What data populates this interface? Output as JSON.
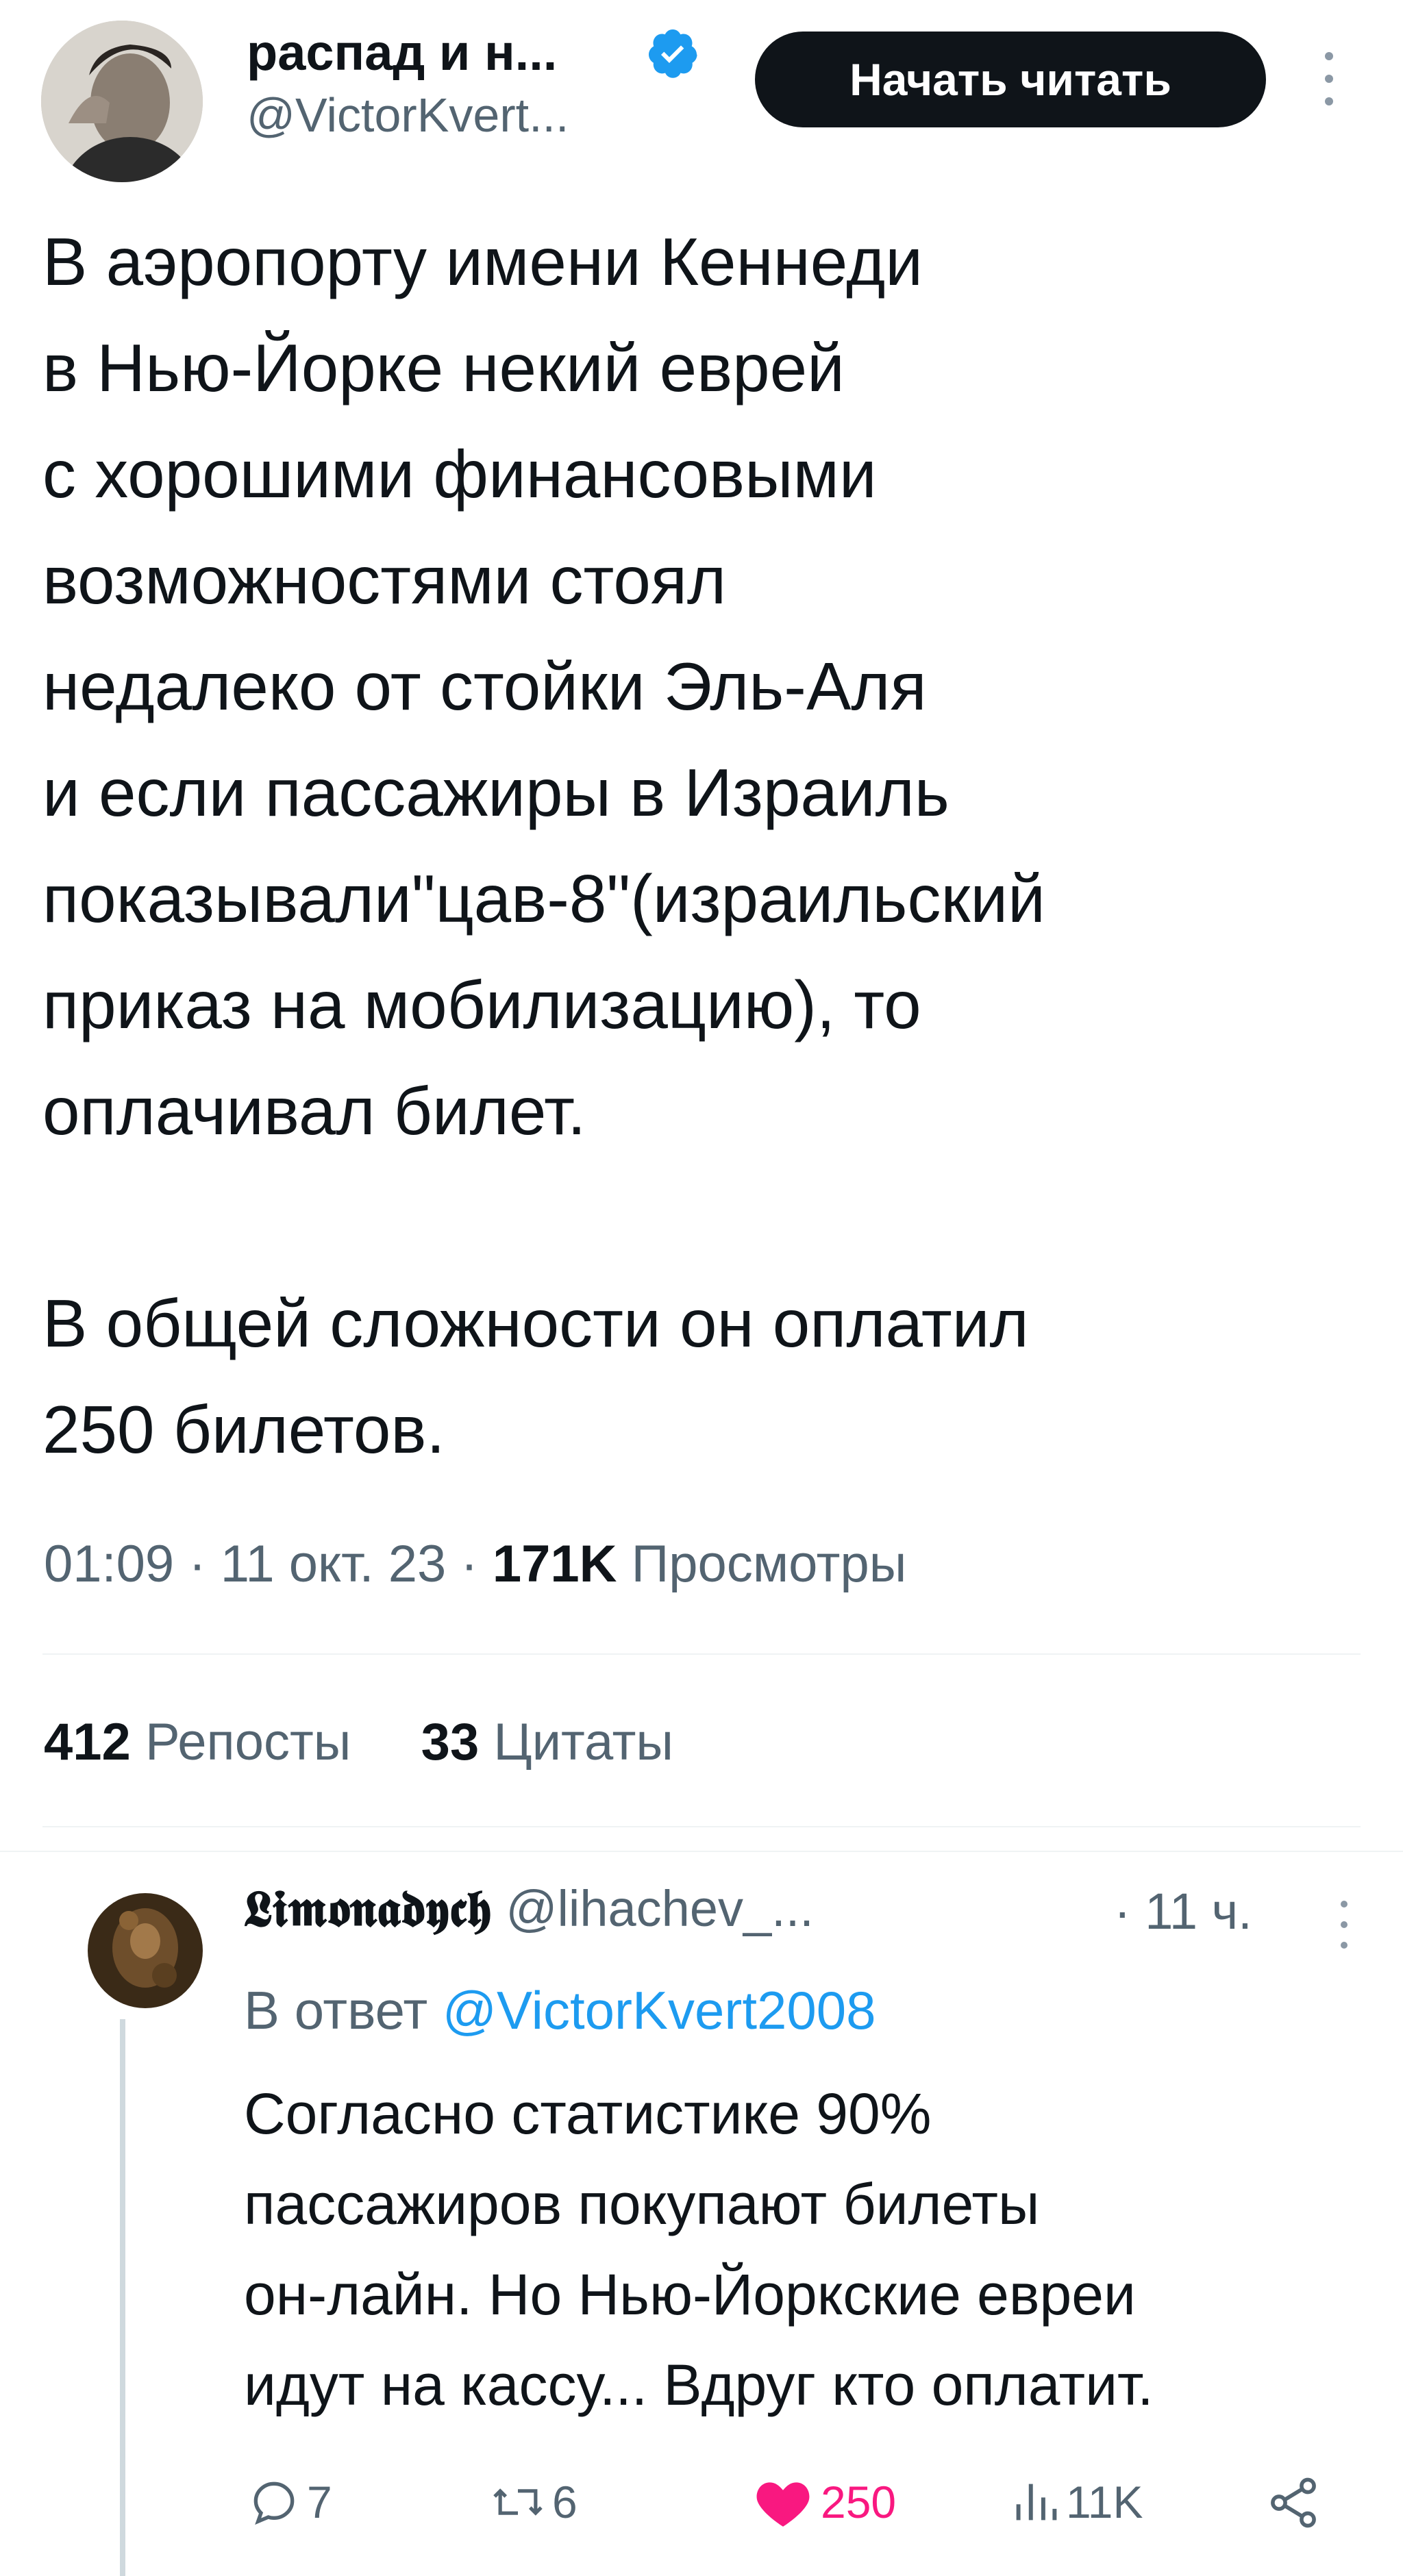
{
  "author": {
    "display_name": "распад и н...",
    "handle": "@VictorKvert...",
    "verified": true,
    "follow_button": "Начать читать"
  },
  "tweet": {
    "lines": [
      "В аэропорту имени Кеннеди",
      "в Нью-Йорке некий еврей",
      "с хорошими финансовыми",
      "возможностями стоял",
      "недалеко от стойки Эль-Аля",
      "и если пассажиры в Израиль",
      "показывали\"цав-8\"(израильский",
      "приказ на мобилизацию), то",
      "оплачивал билет.",
      "В общей сложности он оплатил",
      "250 билетов."
    ],
    "meta": {
      "time": "01:09",
      "sep1": "·",
      "date": "11 окт. 23",
      "sep2": "·",
      "views_count": "171K",
      "views_label": "Просмотры"
    },
    "stats": {
      "reposts_count": "412",
      "reposts_label": "Репосты",
      "quotes_count": "33",
      "quotes_label": "Цитаты"
    }
  },
  "reply": {
    "display_name": "𝕷𝖎𝖒𝖔𝖓𝖆𝖉𝖞𝖈𝖍",
    "handle": "@lihachev_...",
    "time": "· 11 ч.",
    "reply_prefix": "В ответ",
    "reply_to": "@VictorKvert2008",
    "lines": [
      "Согласно статистике 90%",
      "пассажиров покупают билеты",
      "он-лайн. Но Нью-Йоркские евреи",
      "идут на кассу... Вдруг кто оплатит."
    ],
    "actions": {
      "replies": "7",
      "reposts": "6",
      "likes": "250",
      "views": "11K"
    }
  },
  "colors": {
    "text": "#0f1419",
    "muted": "#536471",
    "link": "#1d9bf0",
    "like": "#f91880",
    "button_bg": "#0f1419",
    "divider": "#eff3f4"
  },
  "icons": {
    "verified": "verified-badge-icon",
    "more": "more-vertical-icon",
    "reply": "reply-bubble-icon",
    "repost": "repost-icon",
    "like": "heart-filled-icon",
    "views": "views-bars-icon",
    "share": "share-icon"
  }
}
